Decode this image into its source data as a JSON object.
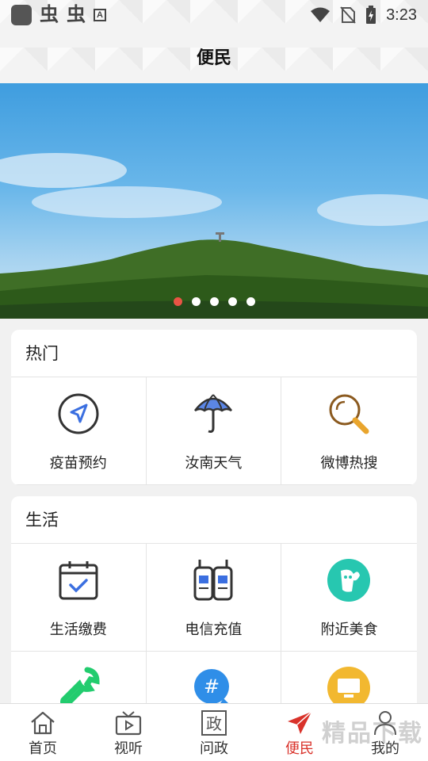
{
  "status_bar": {
    "time": "3:23",
    "glyph1": "虫",
    "glyph2": "虫",
    "a_badge": "A"
  },
  "header": {
    "title": "便民"
  },
  "banner": {
    "slides": 5,
    "active_index": 0
  },
  "sections": [
    {
      "title": "热门",
      "items": [
        {
          "label": "疫苗预约",
          "icon": "navigation-arrow-icon"
        },
        {
          "label": "汝南天气",
          "icon": "umbrella-icon"
        },
        {
          "label": "微博热搜",
          "icon": "magnifier-icon"
        }
      ]
    },
    {
      "title": "生活",
      "items": [
        {
          "label": "生活缴费",
          "icon": "calendar-check-icon"
        },
        {
          "label": "电信充值",
          "icon": "walkie-talkie-icon"
        },
        {
          "label": "附近美食",
          "icon": "food-mascot-icon"
        },
        {
          "label": "",
          "icon": "wrench-icon"
        },
        {
          "label": "",
          "icon": "hashtag-bubble-icon"
        },
        {
          "label": "",
          "icon": "monitor-icon"
        }
      ]
    }
  ],
  "bottom_nav": [
    {
      "label": "首页",
      "icon": "home-icon",
      "active": false
    },
    {
      "label": "视听",
      "icon": "tv-play-icon",
      "active": false
    },
    {
      "label": "问政",
      "icon": "zheng-box-icon",
      "glyph": "政",
      "active": false
    },
    {
      "label": "便民",
      "icon": "paper-plane-icon",
      "active": true
    },
    {
      "label": "我的",
      "icon": "person-icon",
      "active": false
    }
  ],
  "watermark": "精品下载",
  "colors": {
    "accent_red": "#d9322a",
    "dot_active": "#e95445",
    "icon_blue": "#3b6fe0"
  }
}
